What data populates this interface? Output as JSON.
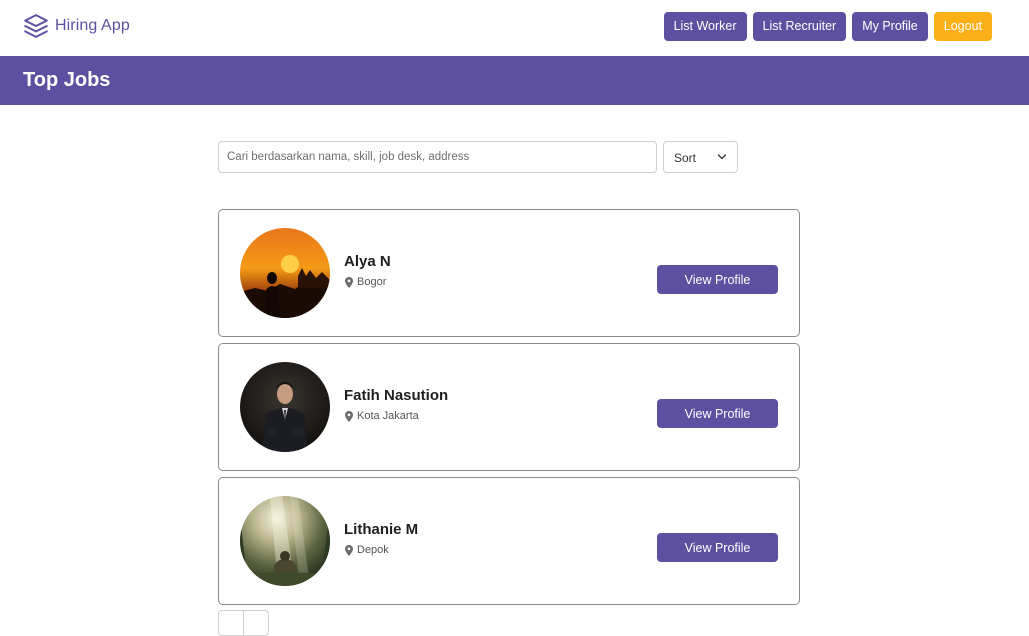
{
  "navbar": {
    "brand": "Hiring App",
    "brand_icon": "stacked-layers-icon",
    "buttons": {
      "list_worker": "List Worker",
      "list_recruiter": "List Recruiter",
      "my_profile": "My Profile",
      "logout": "Logout"
    }
  },
  "banner": {
    "title": "Top Jobs"
  },
  "search": {
    "placeholder": "Cari berdasarkan nama, skill, job desk, address",
    "value": ""
  },
  "sort": {
    "label": "Sort"
  },
  "workers": [
    {
      "name": "Alya N",
      "location": "Bogor",
      "button": "View Profile"
    },
    {
      "name": "Fatih Nasution",
      "location": "Kota Jakarta",
      "button": "View Profile"
    },
    {
      "name": "Lithanie M",
      "location": "Depok",
      "button": "View Profile"
    }
  ],
  "colors": {
    "primary": "#5e50a1",
    "accent": "#fbb017",
    "white": "#ffffff"
  }
}
